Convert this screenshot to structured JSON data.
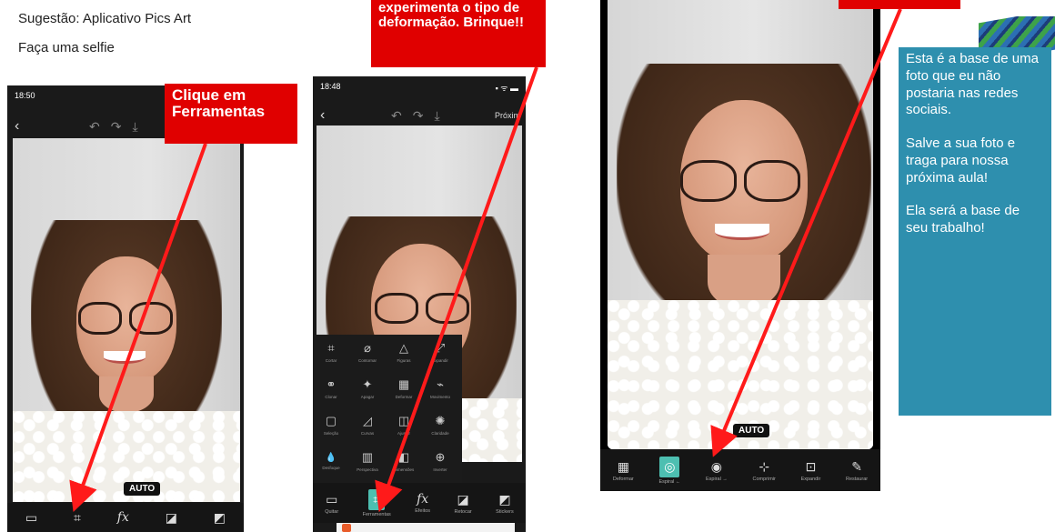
{
  "header": {
    "suggestion": "Sugestão: Aplicativo Pics Art",
    "instruction": "Faça uma selfie"
  },
  "callouts": {
    "tools": "Clique em Ferramentas",
    "deform": "experimenta o tipo de deformação. Brinque!!"
  },
  "phone1": {
    "time": "18:50",
    "auto": "AUTO",
    "toolbar": [
      "▭",
      "⌗",
      "fx",
      "◪",
      "◩"
    ]
  },
  "phone2": {
    "time": "18:48",
    "next": "Próxim",
    "tools": [
      {
        "label": "Cortar",
        "icon": "⌗"
      },
      {
        "label": "Contornar",
        "icon": "⌀"
      },
      {
        "label": "Figuras",
        "icon": "△"
      },
      {
        "label": "Expandir",
        "icon": "⤢"
      },
      {
        "label": "Clonar",
        "icon": "⚭"
      },
      {
        "label": "Apagar",
        "icon": "✦"
      },
      {
        "label": "Deformar",
        "icon": "▦"
      },
      {
        "label": "Movimento",
        "icon": "⌁"
      },
      {
        "label": "Seleção",
        "icon": "▢"
      },
      {
        "label": "Curvas",
        "icon": "◿"
      },
      {
        "label": "Ajustar",
        "icon": "◫"
      },
      {
        "label": "Claridade",
        "icon": "✺"
      },
      {
        "label": "Desfoque",
        "icon": "💧"
      },
      {
        "label": "Perspectiva",
        "icon": "▥"
      },
      {
        "label": "Dimensões",
        "icon": "◧"
      },
      {
        "label": "Inverter",
        "icon": "⊕"
      }
    ],
    "toolbar": [
      {
        "label": "Quitar",
        "icon": "▭"
      },
      {
        "label": "Ferramentas",
        "icon": "⌗"
      },
      {
        "label": "Efeitos",
        "icon": "fx"
      },
      {
        "label": "Retocar",
        "icon": "◪"
      },
      {
        "label": "Stickers",
        "icon": "◩"
      }
    ]
  },
  "phone3": {
    "auto": "AUTO",
    "toolbar": [
      {
        "label": "Deformar",
        "icon": "▦"
      },
      {
        "label": "Espiral ←",
        "icon": "◎"
      },
      {
        "label": "Espiral →",
        "icon": "◉"
      },
      {
        "label": "Comprimir",
        "icon": "⊹"
      },
      {
        "label": "Expandir",
        "icon": "⊡"
      },
      {
        "label": "Restaurar",
        "icon": "✎"
      }
    ]
  },
  "info": {
    "p1": "Esta é a base de uma foto que eu não postaria nas redes sociais.",
    "p2": "Salve a sua foto e traga para nossa próxima aula!",
    "p3": "Ela será a base de seu trabalho!"
  },
  "colors": {
    "callout_red": "#e00000",
    "info_blue": "#2e8fae",
    "active_teal": "#4dbfb1"
  }
}
